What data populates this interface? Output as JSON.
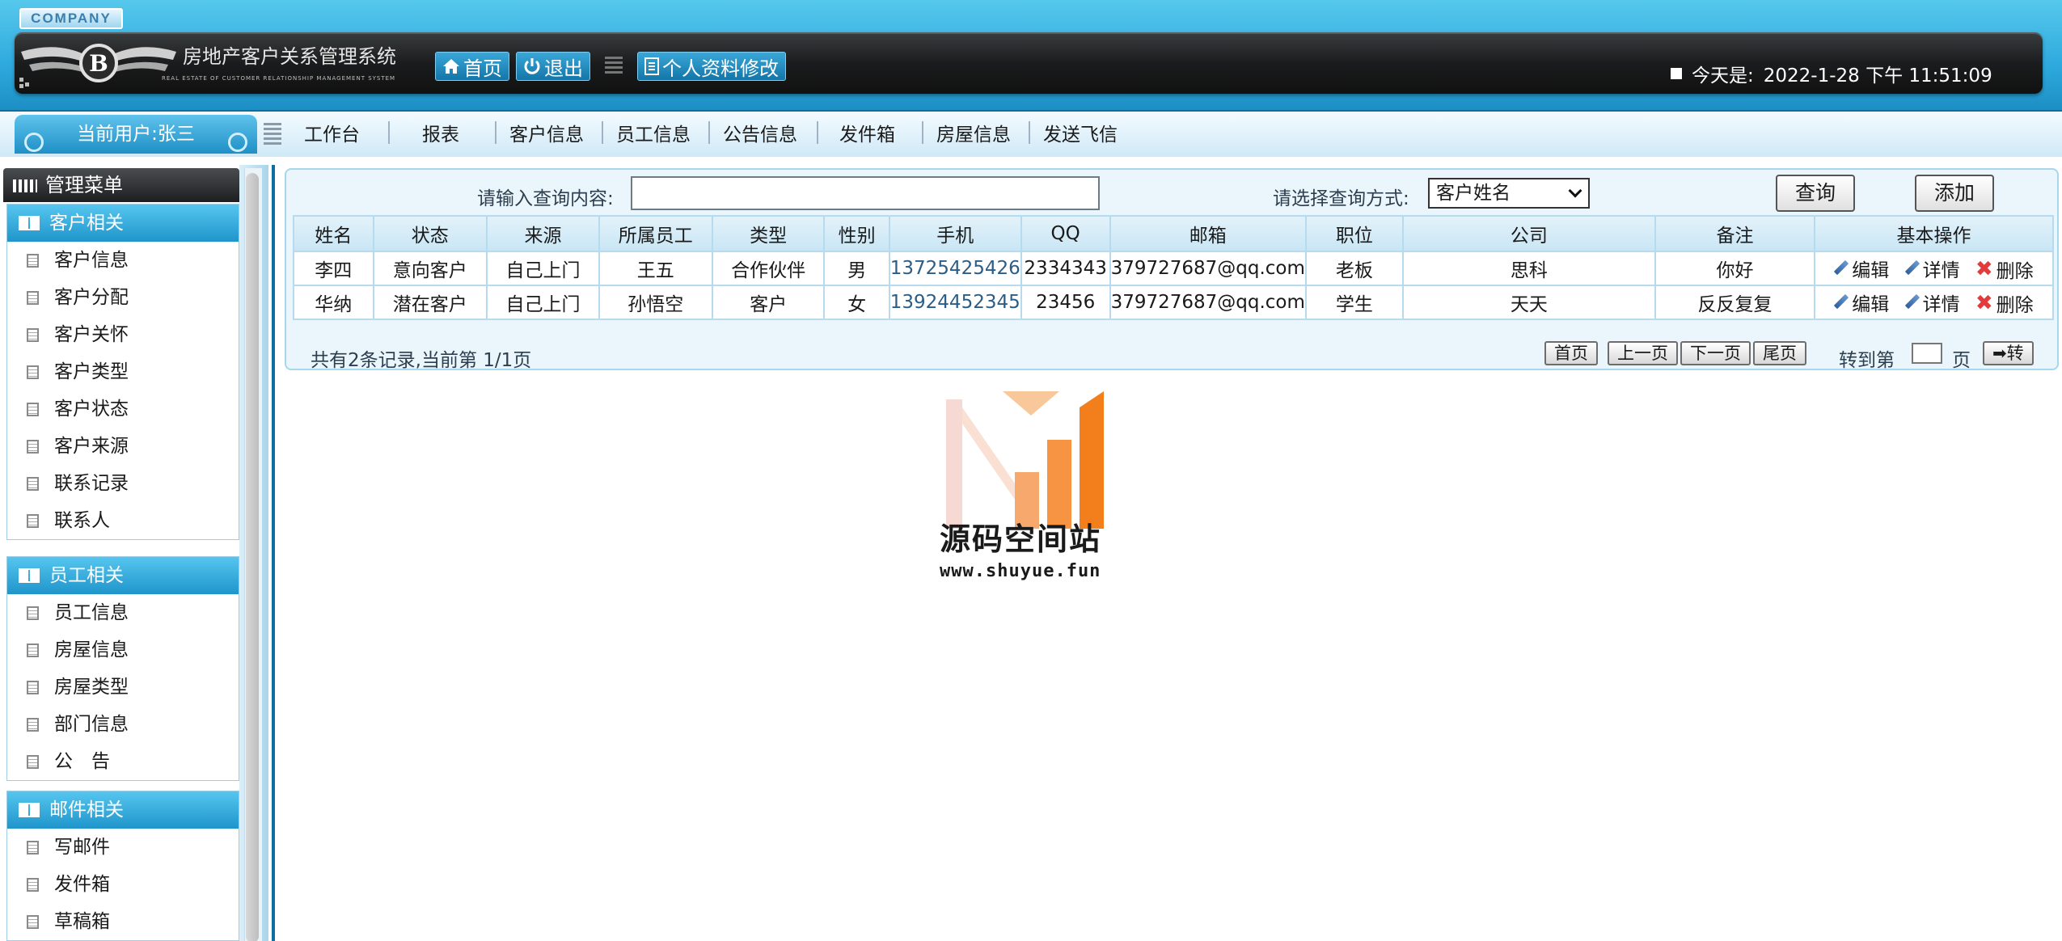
{
  "header": {
    "company": "COMPANY",
    "system_title": "房地产客户关系管理系统",
    "system_subtitle": "REAL ESTATE OF CUSTOMER RELATIONSHIP MANAGEMENT SYSTEM",
    "buttons": {
      "home": "首页",
      "logout": "退出",
      "profile": "个人资料修改"
    },
    "today_label": "今天是:",
    "today_value": "2022-1-28 下午 11:51:09"
  },
  "nav": {
    "current_user": "当前用户:张三",
    "items": [
      "工作台",
      "报表",
      "客户信息",
      "员工信息",
      "公告信息",
      "发件箱",
      "房屋信息",
      "发送飞信"
    ]
  },
  "sidebar": {
    "menu_title": "管理菜单",
    "groups": [
      {
        "title": "客户相关",
        "items": [
          "客户信息",
          "客户分配",
          "客户关怀",
          "客户类型",
          "客户状态",
          "客户来源",
          "联系记录",
          "联系人"
        ]
      },
      {
        "title": "员工相关",
        "items": [
          "员工信息",
          "房屋信息",
          "房屋类型",
          "部门信息",
          "公　告"
        ]
      },
      {
        "title": "邮件相关",
        "items": [
          "写邮件",
          "发件箱",
          "草稿箱"
        ]
      }
    ]
  },
  "search": {
    "content_label": "请输入查询内容:",
    "content_value": "",
    "method_label": "请选择查询方式:",
    "method_selected": "客户姓名",
    "query_button": "查询",
    "add_button": "添加"
  },
  "table": {
    "headers": [
      "姓名",
      "状态",
      "来源",
      "所属员工",
      "类型",
      "性别",
      "手机",
      "QQ",
      "邮箱",
      "职位",
      "公司",
      "备注",
      "基本操作"
    ],
    "rows": [
      [
        "李四",
        "意向客户",
        "自己上门",
        "王五",
        "合作伙伴",
        "男",
        "13725425426",
        "2334343",
        "379727687@qq.com",
        "老板",
        "思科",
        "你好"
      ],
      [
        "华纳",
        "潜在客户",
        "自己上门",
        "孙悟空",
        "客户",
        "女",
        "13924452345",
        "23456",
        "379727687@qq.com",
        "学生",
        "天天",
        "反反复复"
      ]
    ],
    "ops": {
      "edit": "编辑",
      "detail": "详情",
      "delete": "删除"
    }
  },
  "pager": {
    "summary": "共有2条记录,当前第 1/1页",
    "first": "首页",
    "prev": "上一页",
    "next": "下一页",
    "last": "尾页",
    "jump_label": "转到第",
    "jump_unit": "页",
    "go": "➡转"
  },
  "watermark": {
    "title": "源码空间站",
    "url": "www.shuyue.fun"
  },
  "colors": {
    "header_blue": "#2ea9dd",
    "dark_bar": "#1b1c1d",
    "accent_border": "#0f6ea0",
    "delete_red": "#e33b3b"
  }
}
